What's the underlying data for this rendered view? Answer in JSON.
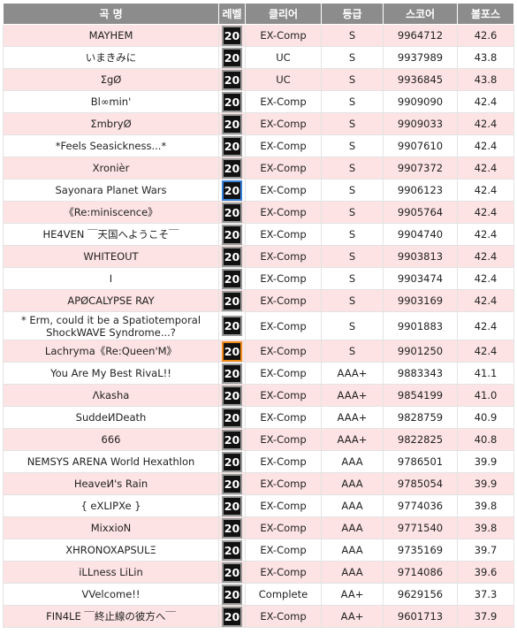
{
  "headers": [
    "곡 명",
    "레벨",
    "클리어",
    "등급",
    "스코어",
    "볼포스"
  ],
  "rows": [
    {
      "song": "MAYHEM",
      "level": "20",
      "clear": "EX-Comp",
      "grade": "S",
      "score": "9964712",
      "volforce": "42.6",
      "badge": "gray"
    },
    {
      "song": "いまきみに",
      "level": "20",
      "clear": "UC",
      "grade": "S",
      "score": "9937989",
      "volforce": "43.8",
      "badge": "gray"
    },
    {
      "song": "ΣgØ",
      "level": "20",
      "clear": "UC",
      "grade": "S",
      "score": "9936845",
      "volforce": "43.8",
      "badge": "gray"
    },
    {
      "song": "Bl∞min'",
      "level": "20",
      "clear": "EX-Comp",
      "grade": "S",
      "score": "9909090",
      "volforce": "42.4",
      "badge": "gray"
    },
    {
      "song": "ΣmbryØ",
      "level": "20",
      "clear": "EX-Comp",
      "grade": "S",
      "score": "9909033",
      "volforce": "42.4",
      "badge": "gray"
    },
    {
      "song": "*Feels Seasickness...*",
      "level": "20",
      "clear": "EX-Comp",
      "grade": "S",
      "score": "9907610",
      "volforce": "42.4",
      "badge": "gray"
    },
    {
      "song": "Xronièr",
      "level": "20",
      "clear": "EX-Comp",
      "grade": "S",
      "score": "9907372",
      "volforce": "42.4",
      "badge": "gray"
    },
    {
      "song": "Sayonara Planet Wars",
      "level": "20",
      "clear": "EX-Comp",
      "grade": "S",
      "score": "9906123",
      "volforce": "42.4",
      "badge": "blue"
    },
    {
      "song": "《Re:miniscence》",
      "level": "20",
      "clear": "EX-Comp",
      "grade": "S",
      "score": "9905764",
      "volforce": "42.4",
      "badge": "gray"
    },
    {
      "song": "HE4VEN ￣天国へようこそ￣",
      "level": "20",
      "clear": "EX-Comp",
      "grade": "S",
      "score": "9904740",
      "volforce": "42.4",
      "badge": "gray"
    },
    {
      "song": "WHITEOUT",
      "level": "20",
      "clear": "EX-Comp",
      "grade": "S",
      "score": "9903813",
      "volforce": "42.4",
      "badge": "gray"
    },
    {
      "song": "I",
      "level": "20",
      "clear": "EX-Comp",
      "grade": "S",
      "score": "9903474",
      "volforce": "42.4",
      "badge": "gray"
    },
    {
      "song": "APØCALYPSE RAY",
      "level": "20",
      "clear": "EX-Comp",
      "grade": "S",
      "score": "9903169",
      "volforce": "42.4",
      "badge": "gray"
    },
    {
      "song": "* Erm, could it be a Spatiotemporal ShockWAVE Syndrome...?",
      "level": "20",
      "clear": "EX-Comp",
      "grade": "S",
      "score": "9901883",
      "volforce": "42.4",
      "badge": "gray",
      "tall": true
    },
    {
      "song": "Lachryma《Re:Queen'M》",
      "level": "20",
      "clear": "EX-Comp",
      "grade": "S",
      "score": "9901250",
      "volforce": "42.4",
      "badge": "orange"
    },
    {
      "song": "You Are My Best RivaL!!",
      "level": "20",
      "clear": "EX-Comp",
      "grade": "AAA+",
      "score": "9883343",
      "volforce": "41.1",
      "badge": "gray"
    },
    {
      "song": "Λkasha",
      "level": "20",
      "clear": "EX-Comp",
      "grade": "AAA+",
      "score": "9854199",
      "volforce": "41.0",
      "badge": "gray"
    },
    {
      "song": "SuddeИDeath",
      "level": "20",
      "clear": "EX-Comp",
      "grade": "AAA+",
      "score": "9828759",
      "volforce": "40.9",
      "badge": "gray"
    },
    {
      "song": "666",
      "level": "20",
      "clear": "EX-Comp",
      "grade": "AAA+",
      "score": "9822825",
      "volforce": "40.8",
      "badge": "gray"
    },
    {
      "song": "NEMSYS ARENA World Hexathlon",
      "level": "20",
      "clear": "EX-Comp",
      "grade": "AAA",
      "score": "9786501",
      "volforce": "39.9",
      "badge": "gray"
    },
    {
      "song": "HeaveИ's Rain",
      "level": "20",
      "clear": "EX-Comp",
      "grade": "AAA",
      "score": "9785054",
      "volforce": "39.9",
      "badge": "gray"
    },
    {
      "song": "{ eXLIPXe }",
      "level": "20",
      "clear": "EX-Comp",
      "grade": "AAA",
      "score": "9774036",
      "volforce": "39.8",
      "badge": "gray"
    },
    {
      "song": "MixxioN",
      "level": "20",
      "clear": "EX-Comp",
      "grade": "AAA",
      "score": "9771540",
      "volforce": "39.8",
      "badge": "gray"
    },
    {
      "song": "XHRONOXAPSULΞ",
      "level": "20",
      "clear": "EX-Comp",
      "grade": "AAA",
      "score": "9735169",
      "volforce": "39.7",
      "badge": "gray"
    },
    {
      "song": "iLLness LiLin",
      "level": "20",
      "clear": "EX-Comp",
      "grade": "AAA",
      "score": "9714086",
      "volforce": "39.6",
      "badge": "gray"
    },
    {
      "song": "VVelcome!!",
      "level": "20",
      "clear": "Complete",
      "grade": "AA+",
      "score": "9629156",
      "volforce": "37.3",
      "badge": "gray"
    },
    {
      "song": "FIN4LE ￣終止線の彼方へ￣",
      "level": "20",
      "clear": "EX-Comp",
      "grade": "AA+",
      "score": "9601713",
      "volforce": "37.9",
      "badge": "gray"
    }
  ]
}
